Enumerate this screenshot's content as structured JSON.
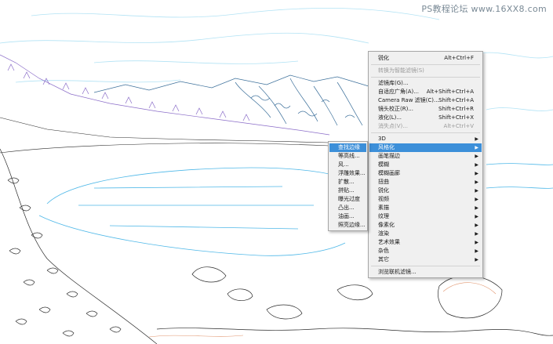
{
  "watermark": "PS教程论坛 www.16XX8.com",
  "main_menu": {
    "items": [
      {
        "label": "锐化",
        "shortcut": "Alt+Ctrl+F",
        "disabled": false,
        "submenu": false
      },
      {
        "label": "转换为智能滤镜(S)",
        "shortcut": "",
        "disabled": true,
        "submenu": false
      },
      {
        "label": "滤镜库(G)...",
        "shortcut": "",
        "disabled": false,
        "submenu": false
      },
      {
        "label": "自适应广角(A)...",
        "shortcut": "Alt+Shift+Ctrl+A",
        "disabled": false,
        "submenu": false
      },
      {
        "label": "Camera Raw 滤镜(C)...",
        "shortcut": "Shift+Ctrl+A",
        "disabled": false,
        "submenu": false
      },
      {
        "label": "镜头校正(R)...",
        "shortcut": "Shift+Ctrl+R",
        "disabled": false,
        "submenu": false
      },
      {
        "label": "液化(L)...",
        "shortcut": "Shift+Ctrl+X",
        "disabled": false,
        "submenu": false
      },
      {
        "label": "消失点(V)...",
        "shortcut": "Alt+Ctrl+V",
        "disabled": true,
        "submenu": false
      },
      {
        "label": "3D",
        "shortcut": "",
        "disabled": false,
        "submenu": true
      },
      {
        "label": "风格化",
        "shortcut": "",
        "disabled": false,
        "submenu": true,
        "highlight": true
      },
      {
        "label": "画笔描边",
        "shortcut": "",
        "disabled": false,
        "submenu": true
      },
      {
        "label": "模糊",
        "shortcut": "",
        "disabled": false,
        "submenu": true
      },
      {
        "label": "模糊画廊",
        "shortcut": "",
        "disabled": false,
        "submenu": true
      },
      {
        "label": "扭曲",
        "shortcut": "",
        "disabled": false,
        "submenu": true
      },
      {
        "label": "锐化",
        "shortcut": "",
        "disabled": false,
        "submenu": true
      },
      {
        "label": "视频",
        "shortcut": "",
        "disabled": false,
        "submenu": true
      },
      {
        "label": "素描",
        "shortcut": "",
        "disabled": false,
        "submenu": true
      },
      {
        "label": "纹理",
        "shortcut": "",
        "disabled": false,
        "submenu": true
      },
      {
        "label": "像素化",
        "shortcut": "",
        "disabled": false,
        "submenu": true
      },
      {
        "label": "渲染",
        "shortcut": "",
        "disabled": false,
        "submenu": true
      },
      {
        "label": "艺术效果",
        "shortcut": "",
        "disabled": false,
        "submenu": true
      },
      {
        "label": "杂色",
        "shortcut": "",
        "disabled": false,
        "submenu": true
      },
      {
        "label": "其它",
        "shortcut": "",
        "disabled": false,
        "submenu": true
      },
      {
        "label": "浏览联机滤镜...",
        "shortcut": "",
        "disabled": false,
        "submenu": false
      }
    ]
  },
  "sub_menu": {
    "items": [
      {
        "label": "查找边缘",
        "highlight": true
      },
      {
        "label": "等高线..."
      },
      {
        "label": "风..."
      },
      {
        "label": "浮雕效果..."
      },
      {
        "label": "扩散..."
      },
      {
        "label": "拼贴..."
      },
      {
        "label": "曝光过度"
      },
      {
        "label": "凸出..."
      },
      {
        "label": "油画..."
      },
      {
        "label": "照亮边缘..."
      }
    ]
  },
  "colors": {
    "menu_bg": "#f0f0f0",
    "highlight": "#3c8fd9",
    "sketch_dark": "#2a2a2a",
    "sketch_blue": "#4fb8e8",
    "sketch_purple": "#8a6cc8"
  }
}
